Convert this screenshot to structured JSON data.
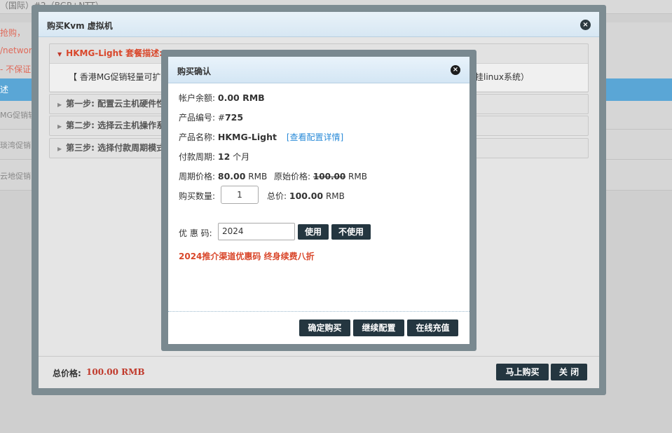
{
  "background": {
    "top_text": "（国际）#2（BGP+NTT）",
    "red_lines": [
      "抢购，",
      "/network",
      "- 不保证"
    ],
    "blue_bar_text": "述",
    "rows": [
      "MG促销轻",
      "琰湾促销",
      "云地促销"
    ]
  },
  "outer_modal": {
    "title": "购买Kvm 虚拟机",
    "close_glyph": "×",
    "accordion": {
      "open_header": "HKMG-Light 套餐描述:",
      "open_body": "【 香港MG促销轻量可扩展",
      "open_body_tail": "挂linux系统）",
      "steps": [
        "第一步: 配置云主机硬件性",
        "第二步: 选择云主机操作系",
        "第三步: 选择付款周期模式"
      ]
    },
    "footer": {
      "total_label": "总价格:",
      "total_value": "100.00 RMB",
      "buy_now": "马上购买",
      "close": "关 闭"
    }
  },
  "confirm_modal": {
    "title": "购买确认",
    "close_glyph": "×",
    "balance_label": "帐户余额:",
    "balance_value": "0.00 RMB",
    "product_no_label": "产品编号:",
    "product_no_prefix": "#",
    "product_no_value": "725",
    "product_name_label": "产品名称:",
    "product_name_value": "HKMG-Light",
    "config_link": "[查看配置详情]",
    "period_label": "付款周期:",
    "period_value": "12",
    "period_unit": "个月",
    "period_price_label": "周期价格:",
    "period_price_value": "80.00",
    "original_price_label": "原始价格:",
    "original_price_value": "100.00",
    "currency": "RMB",
    "qty_label": "购买数量:",
    "qty_value": "1",
    "total_label": "总价:",
    "total_value": "100.00",
    "coupon_label": "优 惠 码:",
    "coupon_value": "2024",
    "use_button": "使用",
    "dont_use_button": "不使用",
    "promo_text": "2024推介渠道优惠码 终身续费八折",
    "confirm_button": "确定购买",
    "continue_button": "继续配置",
    "recharge_button": "在线充值"
  }
}
